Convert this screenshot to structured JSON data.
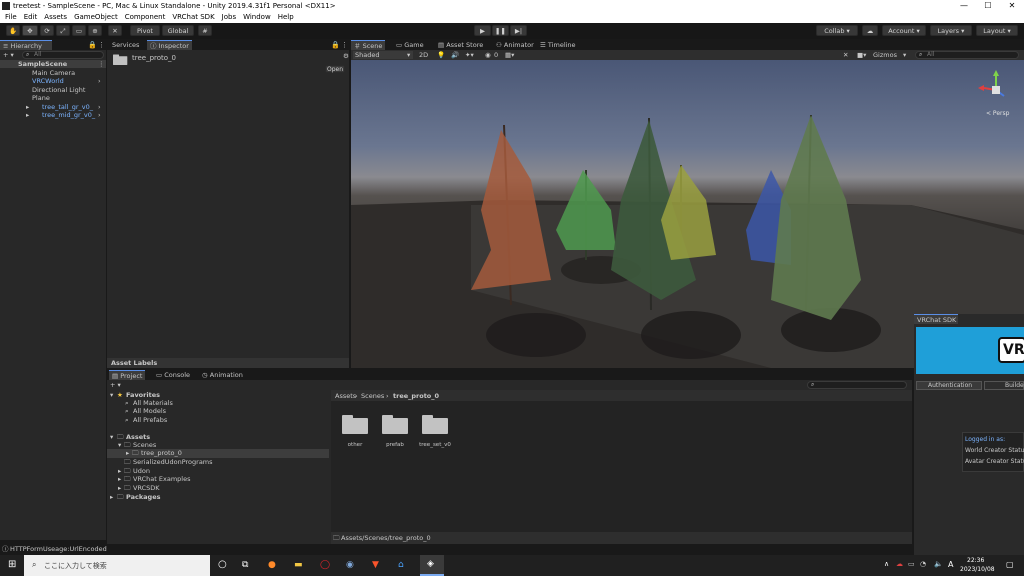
{
  "window": {
    "title": "treetest - SampleScene - PC, Mac & Linux Standalone - Unity 2019.4.31f1 Personal <DX11>",
    "min": "—",
    "max": "☐",
    "close": "✕"
  },
  "menu": [
    "File",
    "Edit",
    "Assets",
    "GameObject",
    "Component",
    "VRChat SDK",
    "Jobs",
    "Window",
    "Help"
  ],
  "toolbar": {
    "pivot": "Pivot",
    "global": "Global",
    "collab": "Collab ▾",
    "account": "Account",
    "layers": "Layers",
    "layout": "Layout"
  },
  "hierarchy": {
    "tab": "Hierarchy",
    "add": "+ ▾",
    "search_placeholder": "All",
    "scene": "SampleScene",
    "items": [
      "Main Camera",
      "VRCWorld",
      "Directional Light",
      "Plane",
      "tree_tall_gr_v0_",
      "tree_mid_gr_v0_"
    ]
  },
  "inspector": {
    "tab_services": "Services",
    "tab_inspector": "Inspector",
    "object": "tree_proto_0",
    "open": "Open",
    "asset_labels": "Asset Labels"
  },
  "scene": {
    "tabs": [
      "Scene",
      "Game",
      "Asset Store",
      "Animator",
      "Timeline"
    ],
    "shading": "Shaded",
    "mode2d": "2D",
    "fx_count": "0",
    "gizmos": "Gizmos",
    "search_placeholder": "All",
    "persp": "< Persp"
  },
  "vrc_sdk": {
    "tab": "VRChat SDK",
    "banner": "VR",
    "tab_auth": "Authentication",
    "tab_build": "Builder",
    "logged_in": "Logged in as:",
    "world_status": "World Creator Status:",
    "avatar_status": "Avatar Creator Status:"
  },
  "project": {
    "tabs": [
      "Project",
      "Console",
      "Animation"
    ],
    "add": "+ ▾",
    "favorites": "Favorites",
    "fav_items": [
      "All Materials",
      "All Models",
      "All Prefabs"
    ],
    "assets": "Assets",
    "tree": [
      "Scenes",
      "tree_proto_0",
      "SerializedUdonPrograms",
      "Udon",
      "VRChat Examples",
      "VRCSDK"
    ],
    "packages": "Packages",
    "breadcrumb": [
      "Assets",
      "Scenes",
      "tree_proto_0"
    ],
    "folders": [
      "other",
      "prefab",
      "tree_set_v0"
    ],
    "footer_path": "Assets/Scenes/tree_proto_0"
  },
  "status": "HTTPFormUseage:UrlEncoded",
  "taskbar": {
    "search": "ここに入力して検索",
    "time": "22:36",
    "date": "2023/10/08",
    "ime": "A"
  },
  "colors": {
    "accent": "#5a8ee6",
    "vrc_banner": "#1f9fd8",
    "tree1": "#a45a3c",
    "tree2": "#4f9a4f",
    "tree3": "#3d5a3d",
    "tree4": "#9aa040",
    "tree5": "#3c57a8",
    "tree6": "#5f7a4f"
  }
}
